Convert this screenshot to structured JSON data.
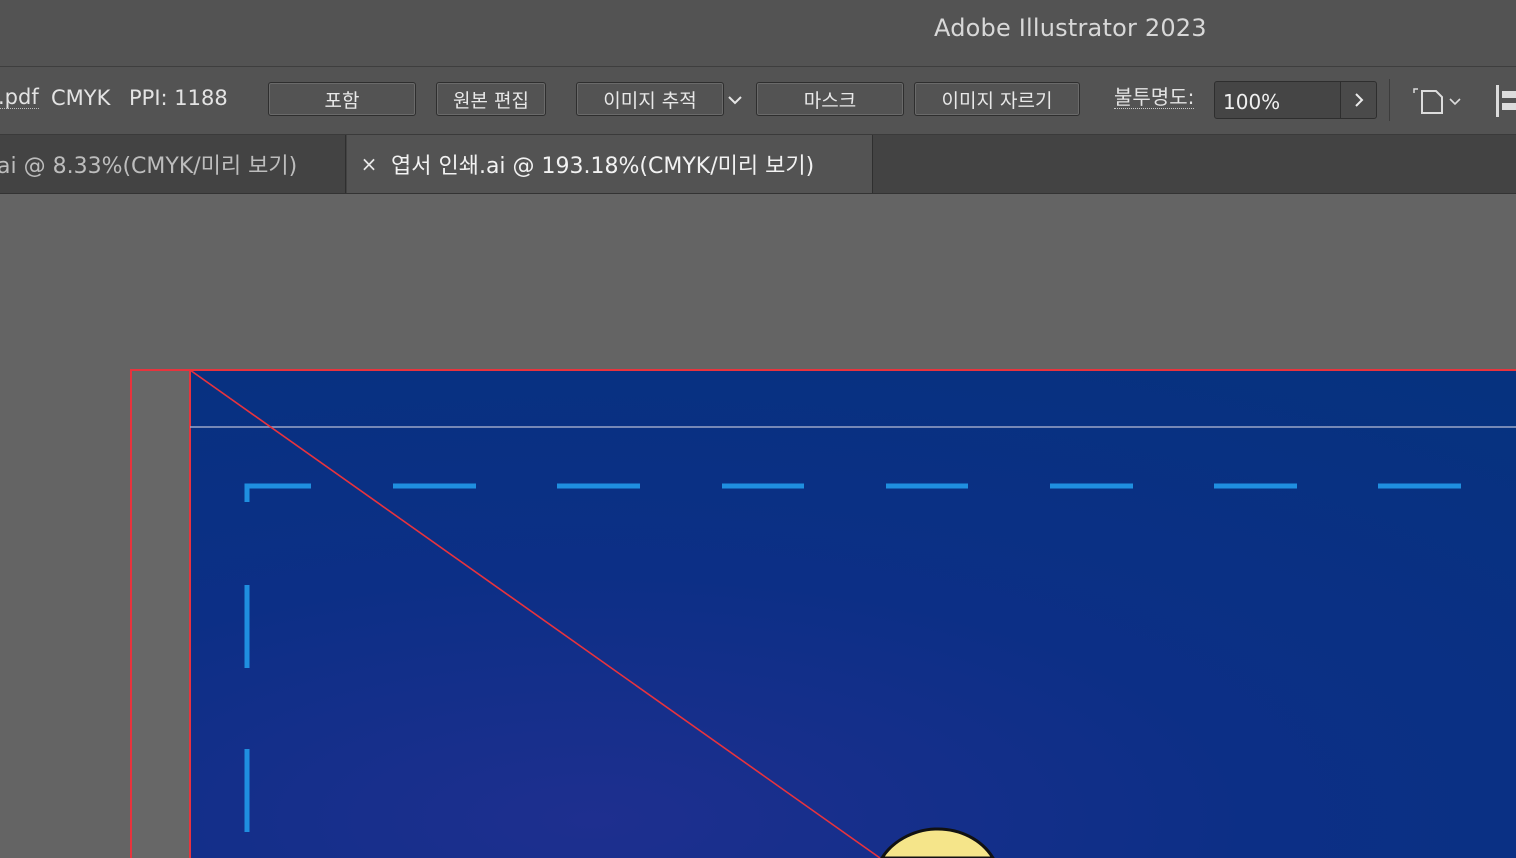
{
  "window": {
    "title": "Adobe Illustrator 2023"
  },
  "control_bar": {
    "file_link": ".pdf",
    "color_mode": "CMYK",
    "ppi": "PPI: 1188",
    "buttons": {
      "embed": "포함",
      "edit_original": "원본 편집",
      "image_trace": "이미지 추적",
      "mask": "마스크",
      "crop_image": "이미지 자르기"
    },
    "opacity_label": "불투명도:",
    "opacity_value": "100%"
  },
  "tabs": [
    {
      "label": "ai @ 8.33%(CMYK/미리 보기)",
      "active": false
    },
    {
      "label": "엽서 인쇄.ai @ 193.18%(CMYK/미리 보기)",
      "active": true,
      "close": "×"
    }
  ],
  "icons": {
    "image_trace_dropdown": "chevron-down-icon",
    "opacity_more": "chevron-right-icon",
    "document_setup": "document-setup-icon",
    "align_panel": "align-icon"
  },
  "colors": {
    "artwork_blue": "#0a2f87",
    "bleed_guide": "#e8333d",
    "safe_area_dash": "#1f8fe0",
    "moon_yellow": "#f5e58a"
  }
}
